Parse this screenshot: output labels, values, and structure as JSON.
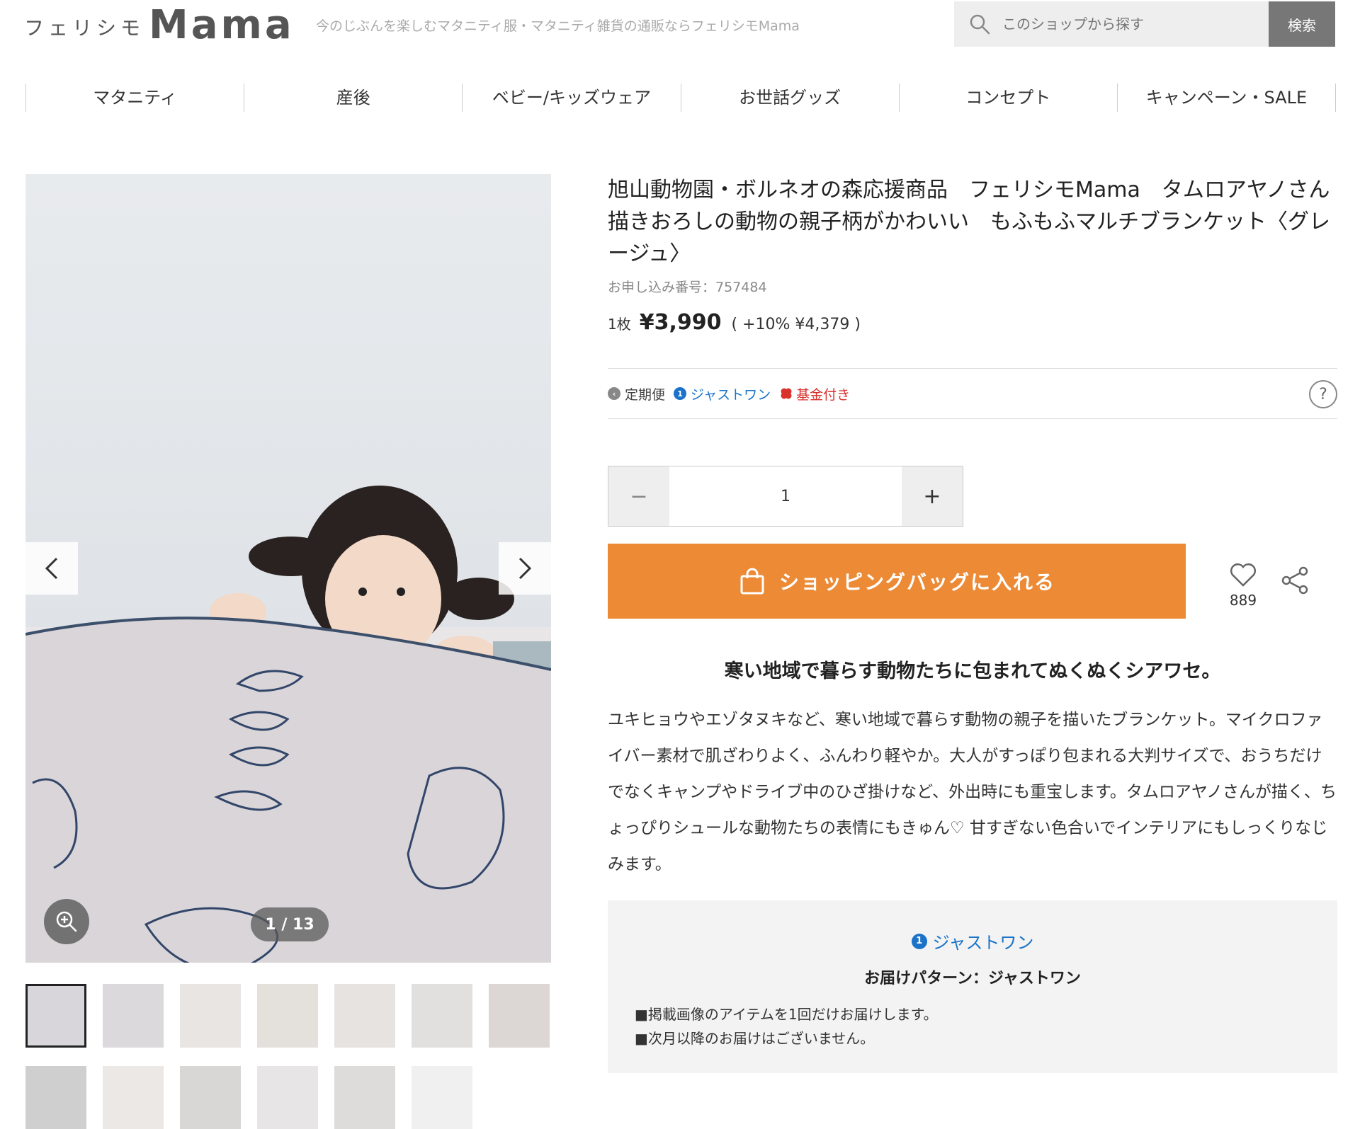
{
  "header": {
    "logo_kana": "フェリシモ",
    "logo_main": "Mama",
    "tagline": "今のじぶんを楽しむマタニティ服・マタニティ雑貨の通販ならフェリシモMama",
    "search_placeholder": "このショップから探す",
    "search_button": "検索"
  },
  "nav": [
    "マタニティ",
    "産後",
    "ベビー/キッズウェア",
    "お世話グッズ",
    "コンセプト",
    "キャンペーン・SALE"
  ],
  "gallery": {
    "counter": "1 / 13",
    "thumb_count": 13
  },
  "product": {
    "title": "旭山動物園・ボルネオの森応援商品　フェリシモMama　タムロアヤノさん描きおろしの動物の親子柄がかわいい　もふもふマルチブランケット〈グレージュ〉",
    "order_no": "お申し込み番号：757484",
    "price_unit": "1枚",
    "price": "¥3,990",
    "price_tax": "( +10%  ¥4,379 )",
    "badges": {
      "teiki": "定期便",
      "just": "ジャストワン",
      "kikin": "基金付き"
    },
    "help": "?",
    "qty_minus": "−",
    "qty_value": "1",
    "qty_plus": "+",
    "cart_button": "ショッピングバッグに入れる",
    "fav_count": "889",
    "catch": "寒い地域で暮らす動物たちに包まれてぬくぬくシアワセ。",
    "description": "ユキヒョウやエゾタヌキなど、寒い地域で暮らす動物の親子を描いたブランケット。マイクロファイバー素材で肌ざわりよく、ふんわり軽やか。大人がすっぽり包まれる大判サイズで、おうちだけでなくキャンプやドライブ中のひざ掛けなど、外出時にも重宝します。タムロアヤノさんが描く、ちょっぴりシュールな動物たちの表情にもきゅん♡ 甘すぎない色合いでインテリアにもしっくりなじみます。"
  },
  "delivery": {
    "badge": "ジャストワン",
    "title": "お届けパターン：ジャストワン",
    "notes": [
      "■掲載画像のアイテムを1回だけお届けします。",
      "■次月以降のお届けはございません。"
    ]
  },
  "colors": {
    "accent": "#ec8a35",
    "link_blue": "#1a73c8",
    "kikin_red": "#d9312b",
    "search_btn": "#777777"
  }
}
